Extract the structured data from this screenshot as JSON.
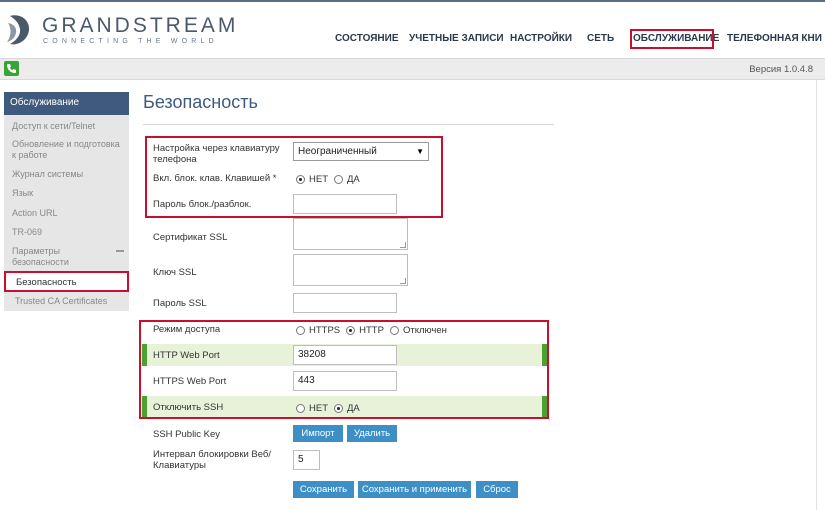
{
  "header": {
    "brand_name": "GRANDSTREAM",
    "brand_tagline": "CONNECTING THE WORLD"
  },
  "nav": {
    "items": [
      "СОСТОЯНИЕ",
      "УЧЕТНЫЕ ЗАПИСИ",
      "НАСТРОЙКИ",
      "СЕТЬ",
      "ОБСЛУЖИВАНИЕ",
      "ТЕЛЕФОННАЯ КНИ"
    ],
    "selected": "ОБСЛУЖИВАНИЕ"
  },
  "toolbar": {
    "version": "Версия 1.0.4.8"
  },
  "sidebar": {
    "header": "Обслуживание",
    "items": [
      "Доступ к сети/Telnet",
      "Обновление и подготовка к работе",
      "Журнал системы",
      "Язык",
      "Action URL",
      "TR-069",
      "Параметры безопасности"
    ],
    "active": "Безопасность",
    "sub_item": "Trusted CA Certificates"
  },
  "page": {
    "title": "Безопасность"
  },
  "form": {
    "keypad_setting_label": "Настройка через клавиатуру телефона",
    "keypad_setting_value": "Неограниченный",
    "keypad_lock_label": "Вкл. блок. клав. Клавишей *",
    "keypad_lock_options": [
      "НЕТ",
      "ДА"
    ],
    "keypad_lock_selected": "НЕТ",
    "lock_password_label": "Пароль блок./разблок.",
    "lock_password_value": "",
    "ssl_cert_label": "Сертификат SSL",
    "ssl_key_label": "Ключ SSL",
    "ssl_password_label": "Пароль SSL",
    "ssl_password_value": "",
    "access_mode_label": "Режим доступа",
    "access_mode_options": [
      "HTTPS",
      "HTTP",
      "Отключен"
    ],
    "access_mode_selected": "HTTP",
    "http_port_label": "HTTP Web Port",
    "http_port_value": "38208",
    "https_port_label": "HTTPS Web Port",
    "https_port_value": "443",
    "disable_ssh_label": "Отключить SSH",
    "disable_ssh_options": [
      "НЕТ",
      "ДА"
    ],
    "disable_ssh_selected": "ДА",
    "ssh_key_label": "SSH Public Key",
    "import_label": "Импорт",
    "delete_label": "Удалить",
    "lock_interval_label": "Интервал блокировки Веб/ Клавиатуры",
    "lock_interval_value": "5"
  },
  "actions": {
    "save": "Сохранить",
    "save_apply": "Сохранить и применить",
    "reset": "Сброс"
  },
  "colors": {
    "accent": "#3f5a7d",
    "button": "#3e8fc6",
    "highlight_box": "#c8102e",
    "row_highlight": "#e8f2d8",
    "row_highlight_edge": "#4aa331"
  }
}
